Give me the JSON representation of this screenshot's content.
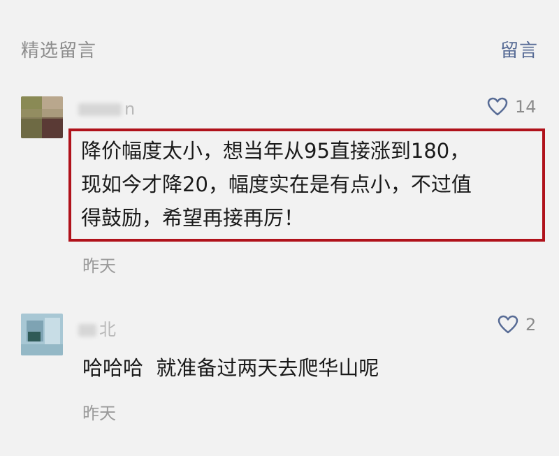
{
  "header": {
    "title": "精选留言",
    "action_label": "留言"
  },
  "comments": [
    {
      "author": "n",
      "likes": "14",
      "text_lines": [
        "降价幅度太小，想当年从95直接涨到180，",
        "现如今才降20，幅度实在是有点小，不过值",
        "得鼓励，希望再接再厉！"
      ],
      "time": "昨天"
    },
    {
      "author": "北",
      "likes": "2",
      "text_lines": [
        "哈哈哈  就准备过两天去爬华山呢"
      ],
      "time": "昨天"
    }
  ],
  "colors": {
    "background": "#f2f2f2",
    "accent": "#576b95",
    "highlight_border": "#b0121b"
  },
  "icons": {
    "like": "heart-outline-icon"
  }
}
